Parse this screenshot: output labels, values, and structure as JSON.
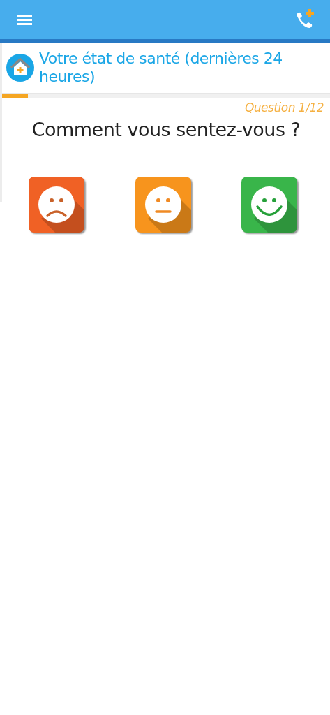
{
  "header": {
    "title": "Votre état de santé (dernières 24 heures)"
  },
  "progress": {
    "level": 0.078
  },
  "question": {
    "counter": "Question 1/12",
    "text": "Comment vous sentez-vous ?"
  },
  "answers": [
    {
      "kind": "sad",
      "color": "#f06125"
    },
    {
      "kind": "neutral",
      "color": "#f7941d"
    },
    {
      "kind": "happy",
      "color": "#39b54a"
    }
  ]
}
